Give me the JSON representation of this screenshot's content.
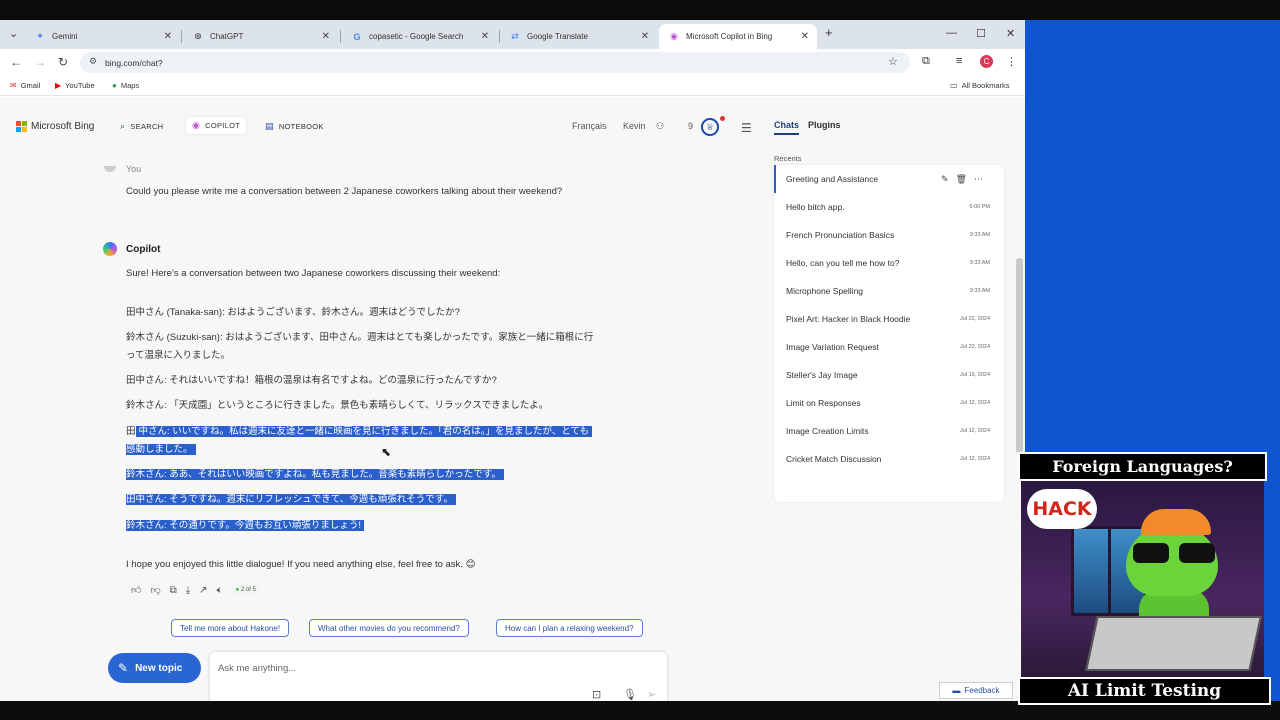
{
  "browser": {
    "tabs": [
      {
        "title": "Gemini",
        "icon": "gemini-icon"
      },
      {
        "title": "ChatGPT",
        "icon": "chatgpt-icon"
      },
      {
        "title": "copasetic - Google Search",
        "icon": "google-icon"
      },
      {
        "title": "Google Translate",
        "icon": "translate-icon"
      },
      {
        "title": "Microsoft Copilot in Bing",
        "icon": "copilot-icon"
      }
    ],
    "url": "bing.com/chat?",
    "profile_initial": "C",
    "bookmarks": [
      "Gmail",
      "YouTube",
      "Maps"
    ],
    "all_bookmarks": "All Bookmarks"
  },
  "header": {
    "brand": "Microsoft Bing",
    "nav": [
      "SEARCH",
      "COPILOT",
      "NOTEBOOK"
    ],
    "language": "Français",
    "user": "Kevin",
    "points": "9"
  },
  "chat": {
    "you_label": "You",
    "user_message": "Could you please write me a conversation between 2 Japanese coworkers talking about their weekend?",
    "copilot_label": "Copilot",
    "intro": "Sure! Here’s a conversation between two Japanese coworkers discussing their weekend:",
    "lines": [
      "田中さん (Tanaka-san): おはようございます、鈴木さん。週末はどうでしたか?",
      "鈴木さん (Suzuki-san): おはようございます、田中さん。週末はとても楽しかったです。家族と一緒に箱根に行",
      "って温泉に入りました。",
      "田中さん: それはいいですね！箱根の温泉は有名ですよね。どの温泉に行ったんですか?",
      "鈴木さん: 「天成園」というところに行きました。景色も素晴らしくて、リラックスできましたよ。"
    ],
    "line6_start": "田",
    "line6_rest": "中さん: いいですね。私は週末に友達と一緒に映画を見に行きました。「君の名は。」を見ましたが、とても",
    "line7": "感動しました。",
    "line8": "鈴木さん: ああ、それはいい映画ですよね。私も見ました。音楽も素晴らしかったです。",
    "line9": "田中さん: そうですね。週末にリフレッシュできて、今週も頑張れそうです。",
    "line10": "鈴木さん: その通りです。今週もお互い頑張りましょう!",
    "outro": "I hope you enjoyed this little dialogue! If you need anything else, feel free to ask. 😊",
    "pager": "2 of 5",
    "suggestions": [
      "Tell me more about Hakone!",
      "What other movies do you recommend?",
      "How can I plan a relaxing weekend?"
    ],
    "new_topic": "New topic",
    "input_placeholder": "Ask me anything..."
  },
  "sidebar": {
    "tabs": [
      "Chats",
      "Plugins"
    ],
    "recents_label": "Recents",
    "items": [
      {
        "title": "Greeting and Assistance",
        "date": ""
      },
      {
        "title": "Hello bitch app.",
        "date": "6:00 PM"
      },
      {
        "title": "French Pronunciation Basics",
        "date": "9:33 AM"
      },
      {
        "title": "Hello, can you tell me how to?",
        "date": "9:33 AM"
      },
      {
        "title": "Microphone Spelling",
        "date": "9:33 AM"
      },
      {
        "title": "Pixel Art: Hacker in Black Hoodie",
        "date": "Jul 22, 2024"
      },
      {
        "title": "Image Variation Request",
        "date": "Jul 22, 2024"
      },
      {
        "title": "Steller's Jay Image",
        "date": "Jul 19, 2024"
      },
      {
        "title": "Limit on Responses",
        "date": "Jul 12, 2024"
      },
      {
        "title": "Image Creation Limits",
        "date": "Jul 12, 2024"
      },
      {
        "title": "Cricket Match Discussion",
        "date": "Jul 12, 2024"
      }
    ],
    "feedback": "Feedback"
  },
  "overlay": {
    "top_title": "Foreign Languages?",
    "bubble_text": "HACK",
    "bottom_title": "AI Limit Testing"
  },
  "colors": {
    "accent": "#2a65d4",
    "highlight": "#2a5fcc",
    "desktop": "#0f55d0"
  }
}
